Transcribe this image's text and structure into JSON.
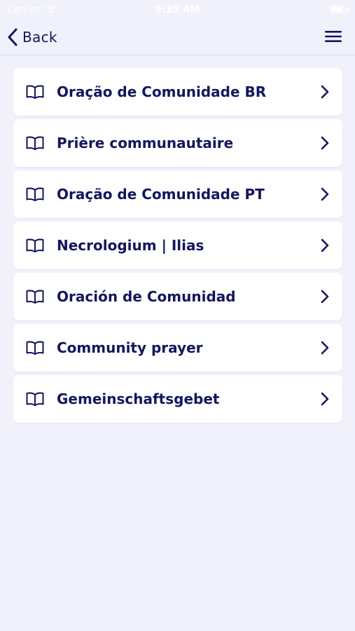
{
  "status_bar": {
    "carrier": "Carrier",
    "time": "9:35 AM"
  },
  "nav": {
    "back_label": "Back"
  },
  "items": [
    {
      "label": "Oração de Comunidade BR"
    },
    {
      "label": "Prière communautaire"
    },
    {
      "label": "Oração de Comunidade PT"
    },
    {
      "label": "Necrologium | Ilias"
    },
    {
      "label": "Oración de Comunidad"
    },
    {
      "label": "Community prayer"
    },
    {
      "label": "Gemeinschaftsgebet"
    }
  ],
  "colors": {
    "background": "#f0f1fb",
    "card": "#ffffff",
    "accent_text": "#14165e"
  }
}
